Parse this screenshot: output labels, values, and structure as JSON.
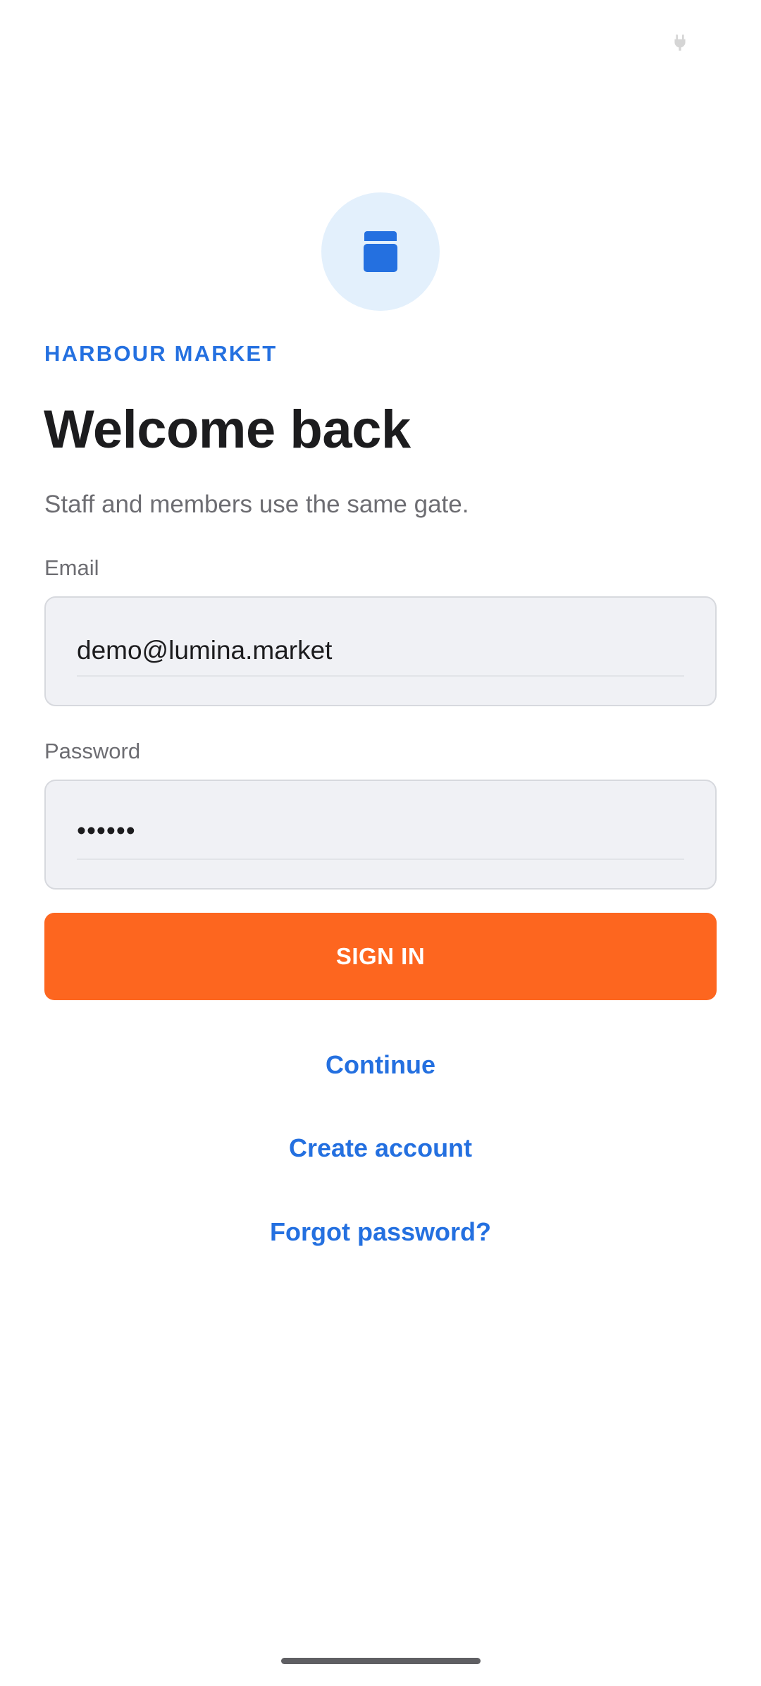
{
  "status_bar": {
    "icon": "plug-icon"
  },
  "logo": {
    "icon": "store-icon",
    "bg_color": "#e3f0fc",
    "icon_color": "#2470e0"
  },
  "brand": {
    "name": "HARBOUR MARKET"
  },
  "header": {
    "title": "Welcome back",
    "subtitle": "Staff and members use the same gate."
  },
  "form": {
    "email": {
      "label": "Email",
      "value": "demo@lumina.market"
    },
    "password": {
      "label": "Password",
      "value": "••••••"
    },
    "submit_label": "SIGN IN"
  },
  "links": {
    "continue": "Continue",
    "create_account": "Create account",
    "forgot_password": "Forgot password?"
  },
  "colors": {
    "accent": "#2470e0",
    "primary_button": "#fd661f",
    "text_primary": "#1c1c1e",
    "text_secondary": "#6d6d72"
  }
}
